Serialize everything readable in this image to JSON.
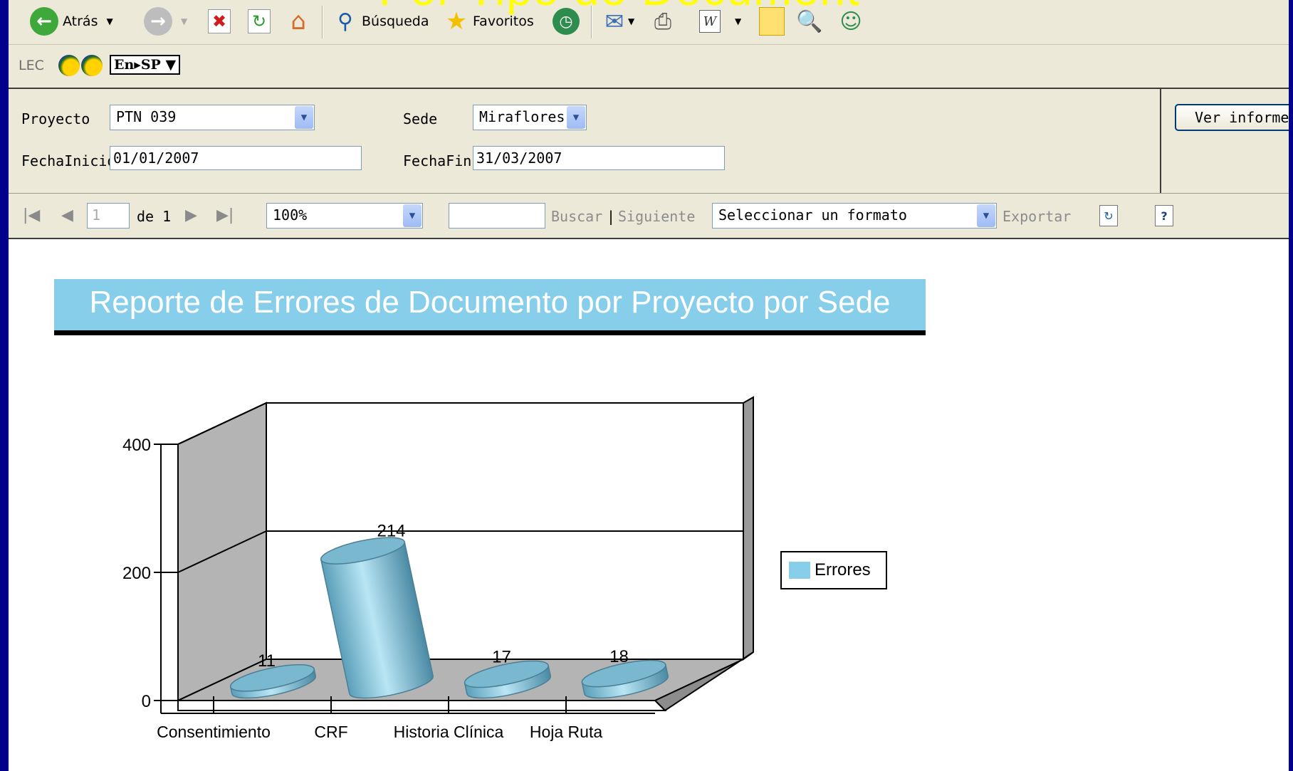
{
  "slide_title_fragment": "Por Tipo de Document",
  "ie_toolbar": {
    "back_label": "Atrás",
    "search_label": "Búsqueda",
    "favorites_label": "Favoritos"
  },
  "links_bar": {
    "lec_label": "LEC",
    "translator_label": "En▸SP"
  },
  "params": {
    "project_label": "Proyecto",
    "project_value": "PTN 039",
    "site_label": "Sede",
    "site_value": "Miraflores",
    "start_label": "FechaInicio",
    "start_value": "01/01/2007",
    "end_label": "FechaFin",
    "end_value": "31/03/2007",
    "view_report_label": "Ver informe"
  },
  "report_toolbar": {
    "page_value": "1",
    "page_of": "de 1",
    "zoom_value": "100%",
    "find_label": "Buscar",
    "separator": "|",
    "next_label": "Siguiente",
    "format_value": "Seleccionar un formato",
    "export_label": "Exportar"
  },
  "report": {
    "title": "Reporte de Errores de Documento por Proyecto por Sede"
  },
  "chart_data": {
    "type": "bar",
    "style": "3d-cylinder",
    "title": "",
    "xlabel": "",
    "ylabel": "",
    "categories": [
      "Consentimiento",
      "CRF",
      "Historia Clínica",
      "Hoja Ruta"
    ],
    "series": [
      {
        "name": "Errores",
        "values": [
          11,
          214,
          17,
          18
        ]
      }
    ],
    "data_labels": [
      "11",
      "214",
      "17",
      "18"
    ],
    "y_ticks": [
      "0",
      "200",
      "400"
    ],
    "ylim": [
      0,
      400
    ],
    "grid": true,
    "legend_position": "right",
    "colors": {
      "bar": "#87ceeb",
      "wall": "#b4b4b4",
      "floor": "#b4b4b4"
    }
  },
  "colors": {
    "title_bar": "#87ceeb",
    "toolbar": "#ece9d8",
    "slide_bg": "#00008b",
    "slide_title": "#ffff00"
  },
  "icons": [
    "back-icon",
    "forward-icon",
    "stop-icon",
    "refresh-icon",
    "home-icon",
    "search-icon",
    "favorites-star-icon",
    "history-icon",
    "mail-icon",
    "print-icon",
    "word-icon",
    "note-icon",
    "research-icon",
    "messenger-icon",
    "first-page-icon",
    "prev-page-icon",
    "next-page-icon",
    "last-page-icon",
    "report-refresh-icon",
    "help-icon"
  ]
}
